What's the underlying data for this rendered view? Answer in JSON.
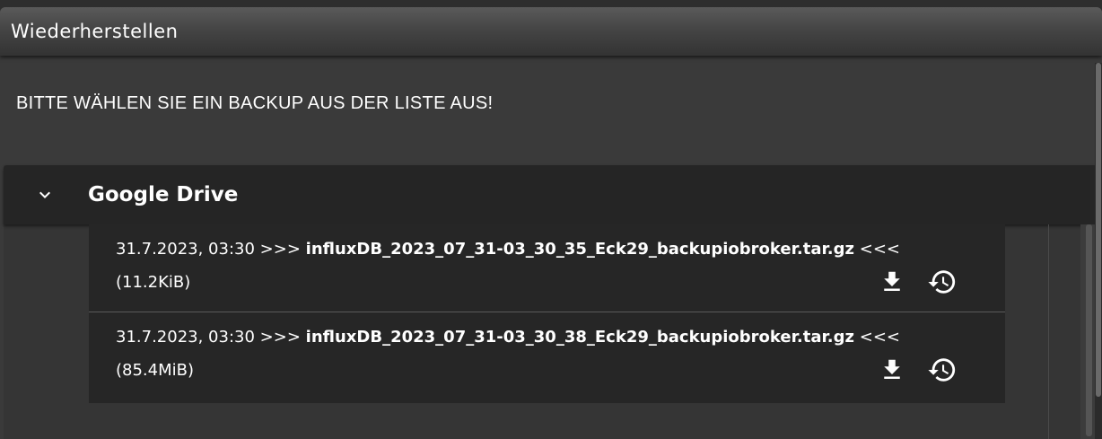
{
  "dialog": {
    "title": "Wiederherstellen",
    "prompt": "BITTE WÄHLEN SIE EIN BACKUP AUS DER LISTE AUS!"
  },
  "accordion": {
    "title": "Google Drive",
    "expanded": true,
    "icon": "chevron-down-icon"
  },
  "backups": [
    {
      "datetime": "31.7.2023, 03:30",
      "prefix": ">>>",
      "filename": "influxDB_2023_07_31-03_30_35_Eck29_backupiobroker.tar.gz",
      "suffix": "<<<",
      "size": "(11.2KiB)"
    },
    {
      "datetime": "31.7.2023, 03:30",
      "prefix": ">>>",
      "filename": "influxDB_2023_07_31-03_30_38_Eck29_backupiobroker.tar.gz",
      "suffix": "<<<",
      "size": "(85.4MiB)"
    }
  ],
  "colors": {
    "background": "#3a3a3a",
    "itemBackground": "#262626",
    "text": "#ffffff"
  }
}
